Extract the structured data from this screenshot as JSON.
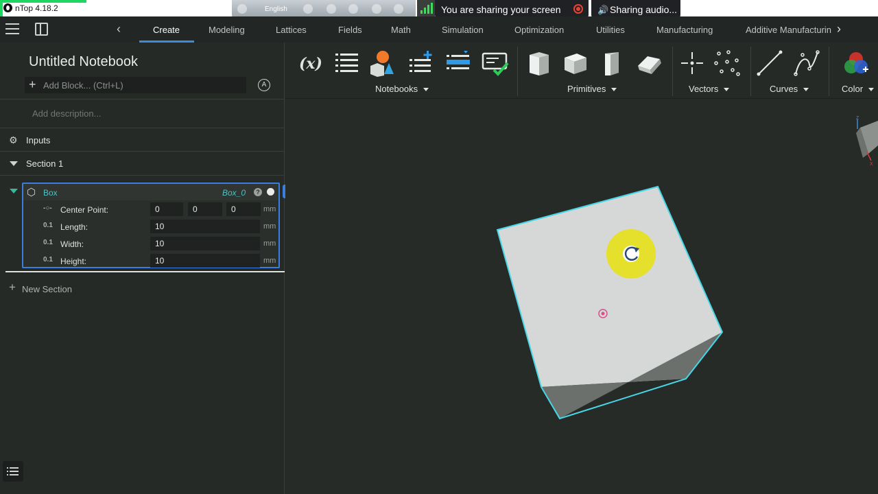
{
  "titlebar": {
    "title": "nTop 4.18.2"
  },
  "taskbar": {
    "language": "English"
  },
  "screen_share": {
    "message": "You are sharing your screen",
    "audio": "Sharing audio..."
  },
  "tabs": [
    "Create",
    "Modeling",
    "Lattices",
    "Fields",
    "Math",
    "Simulation",
    "Optimization",
    "Utilities",
    "Manufacturing",
    "Additive Manufacturin"
  ],
  "notebook": {
    "title": "Untitled Notebook",
    "add_block_placeholder": "Add Block... (Ctrl+L)",
    "description_placeholder": "Add description...",
    "inputs_label": "Inputs",
    "section_label": "Section 1",
    "new_section_label": "New Section",
    "block": {
      "name": "Box",
      "variable": "Box_0",
      "params": [
        {
          "label": "Center Point:",
          "values": [
            "0",
            "0",
            "0"
          ],
          "unit": "mm"
        },
        {
          "label": "Length:",
          "value": "10",
          "unit": "mm"
        },
        {
          "label": "Width:",
          "value": "10",
          "unit": "mm"
        },
        {
          "label": "Height:",
          "value": "10",
          "unit": "mm"
        }
      ]
    }
  },
  "ribbon": {
    "groups": [
      "Notebooks",
      "Primitives",
      "Vectors",
      "Curves",
      "Color"
    ],
    "formula_icon_text": "(x)"
  },
  "viewport": {
    "axis_labels": [
      "Z",
      "X"
    ]
  },
  "colors": {
    "accent": "#3a8dde",
    "block_border": "#3a7ee0",
    "block_name": "#4fc3c4",
    "cube_outline": "#47d6e6",
    "cursor_highlight": "#e6e11a"
  }
}
